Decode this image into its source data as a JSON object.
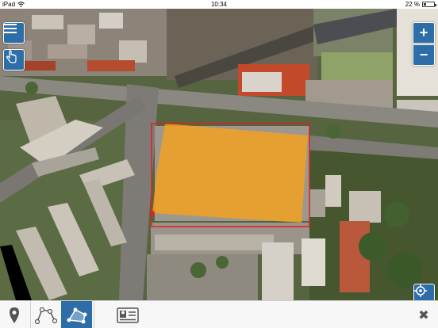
{
  "status_bar": {
    "device": "iPad",
    "time": "10:34",
    "battery_text": "22 %",
    "battery_level": 0.22
  },
  "map": {
    "selection_fill_color": "#f7a21c",
    "selection_stroke_color": "#e02020"
  },
  "controls": {
    "menu_icon": "hamburger-menu-icon",
    "pan_icon": "hand-pointer-icon",
    "zoom_in_label": "+",
    "zoom_out_label": "−",
    "locate_icon": "crosshair-locate-icon"
  },
  "toolbar": {
    "active_tool": "polygon",
    "items": [
      {
        "icon": "map-pin-icon"
      },
      {
        "icon": "polyline-icon"
      },
      {
        "icon": "polygon-icon"
      },
      {
        "icon": "form-card-icon"
      },
      {
        "icon": "close-icon"
      }
    ],
    "close_label": "✖"
  },
  "colors": {
    "accent": "#2d6ea8",
    "toolbar_bg": "#f7f7f7"
  }
}
